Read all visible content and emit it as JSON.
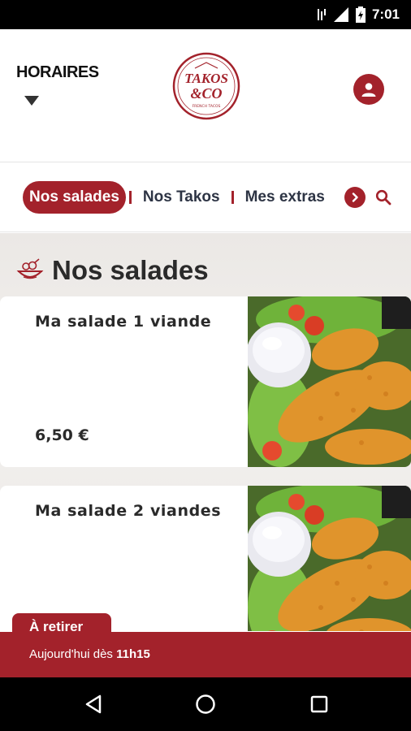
{
  "status_bar": {
    "time": "7:01"
  },
  "header": {
    "schedule_label": "HORAIRES",
    "logo": {
      "line1": "TAKOS",
      "line2": "&CO",
      "tagline": "FRENCH TACOS"
    }
  },
  "categories": {
    "tabs": [
      {
        "label": "Nos salades",
        "active": true
      },
      {
        "label": "Nos Takos",
        "active": false
      },
      {
        "label": "Mes extras",
        "active": false
      }
    ]
  },
  "section": {
    "title": "Nos salades"
  },
  "products": [
    {
      "name": "Ma salade 1 viande",
      "price": "6,50 €"
    },
    {
      "name": "Ma salade 2 viandes",
      "price": ""
    }
  ],
  "pickup": {
    "mode": "À retirer",
    "text": "Aujourd'hui dès",
    "time": "11h15"
  },
  "colors": {
    "brand": "#a3222b",
    "background": "#efece9"
  }
}
